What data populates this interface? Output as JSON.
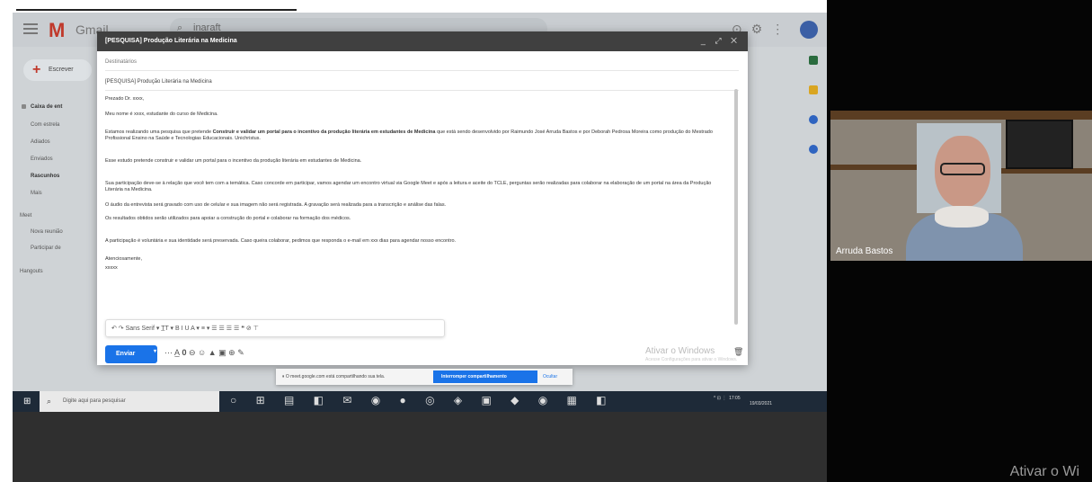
{
  "gmail": {
    "logo_letter": "M",
    "app_name": "Gmail",
    "search_value": "inaraft",
    "compose_label": "Escrever",
    "nav": [
      "Caixa de ent",
      "Com estrela",
      "Adiados",
      "Enviados",
      "Rascunhos",
      "Mais"
    ],
    "meet_heading": "Meet",
    "meet_items": [
      "Nova reunião",
      "Participar de"
    ],
    "hangouts_heading": "Hangouts"
  },
  "compose": {
    "window_title": "[PESQUISA] Produção Literária na Medicina",
    "window_controls": "_ ⤢ ✕",
    "to_placeholder": "Destinatários",
    "subject": "[PESQUISA] Produção Literária na Medicina",
    "greeting": "Prezado Dr. xxxx,",
    "intro": "Meu nome é xxxx, estudante do curso de Medicina.",
    "para1_before": "Estamos realizando uma pesquisa que pretende ",
    "para1_bold": "Construir e validar um portal para o incentivo da produção literária em estudantes de Medicina",
    "para1_after": " que está sendo desenvolvido por Raimundo José Arruda Bastos e por Deborah Pedrosa Moreira como produção do Mestrado Profissional Ensino na Saúde e Tecnologias Educacionais. Unichristus.",
    "para2": "Esse estudo pretende construir e validar um portal para o incentivo da produção literária em estudantes de Medicina.",
    "para3": "Sua participação deve-se à relação que você tem com a temática. Caso concorde em participar, vamos agendar um encontro virtual via Google Meet e após a leitura e aceite do TCLE, perguntas serão realizadas para colaborar na elaboração de um portal na área da Produção Literária na Medicina.",
    "para4": "O áudio da entrevista será gravado com uso de celular e sua imagem não será registrada. A gravação será realizada para a transcrição e análise das falas.",
    "para5": "Os resultados obtidos serão utilizados para apoiar a construção do portal e colaborar na formação dos médicos.",
    "para6": "A participação é voluntária e sua identidade será preservada. Caso queira colaborar, pedimos que responda o e-mail em xxx dias para agendar nosso encontro.",
    "closing": "Atenciosamente,",
    "signature": "xxxxx",
    "format_toolbar": "↶  ↷  Sans Serif ▾   T̲T ▾   B   I   U   A ▾   ≡ ▾   ☰   ☰   ☰   ☰   ❝   ⊘   ⊤",
    "send_label": "Enviar",
    "send_arrow": "▾",
    "bottom_tools": "⋯  A̲  𝟎  ⊖  ☺  ▲  ▣  ⊕  ✎",
    "watermark_line1": "Ativar o Windows",
    "watermark_line2": "Acesse Configurações para ativar o Windows."
  },
  "sharebar": {
    "message": "⏸ O meet.google.com está compartilhando sua tela.",
    "stop_label": "Interromper compartilhamento",
    "hide_label": "Ocultar"
  },
  "taskbar": {
    "start_icon": "⊞",
    "search_placeholder": "Digite aqui para pesquisar",
    "search_icon": "⌕",
    "app_icons": "○ ⊞ ▤ ◧ ✉ ◉ ● ◎ ◈ ▣ ◆ ◉ ▦ ◧",
    "tray_time": "17:05",
    "tray_date": "19/03/2021",
    "tray_icons": "^ ⊡ ⋮"
  },
  "webcam": {
    "name_label": "Arruda Bastos"
  },
  "screen_corner_text": "Ativar o Wi"
}
